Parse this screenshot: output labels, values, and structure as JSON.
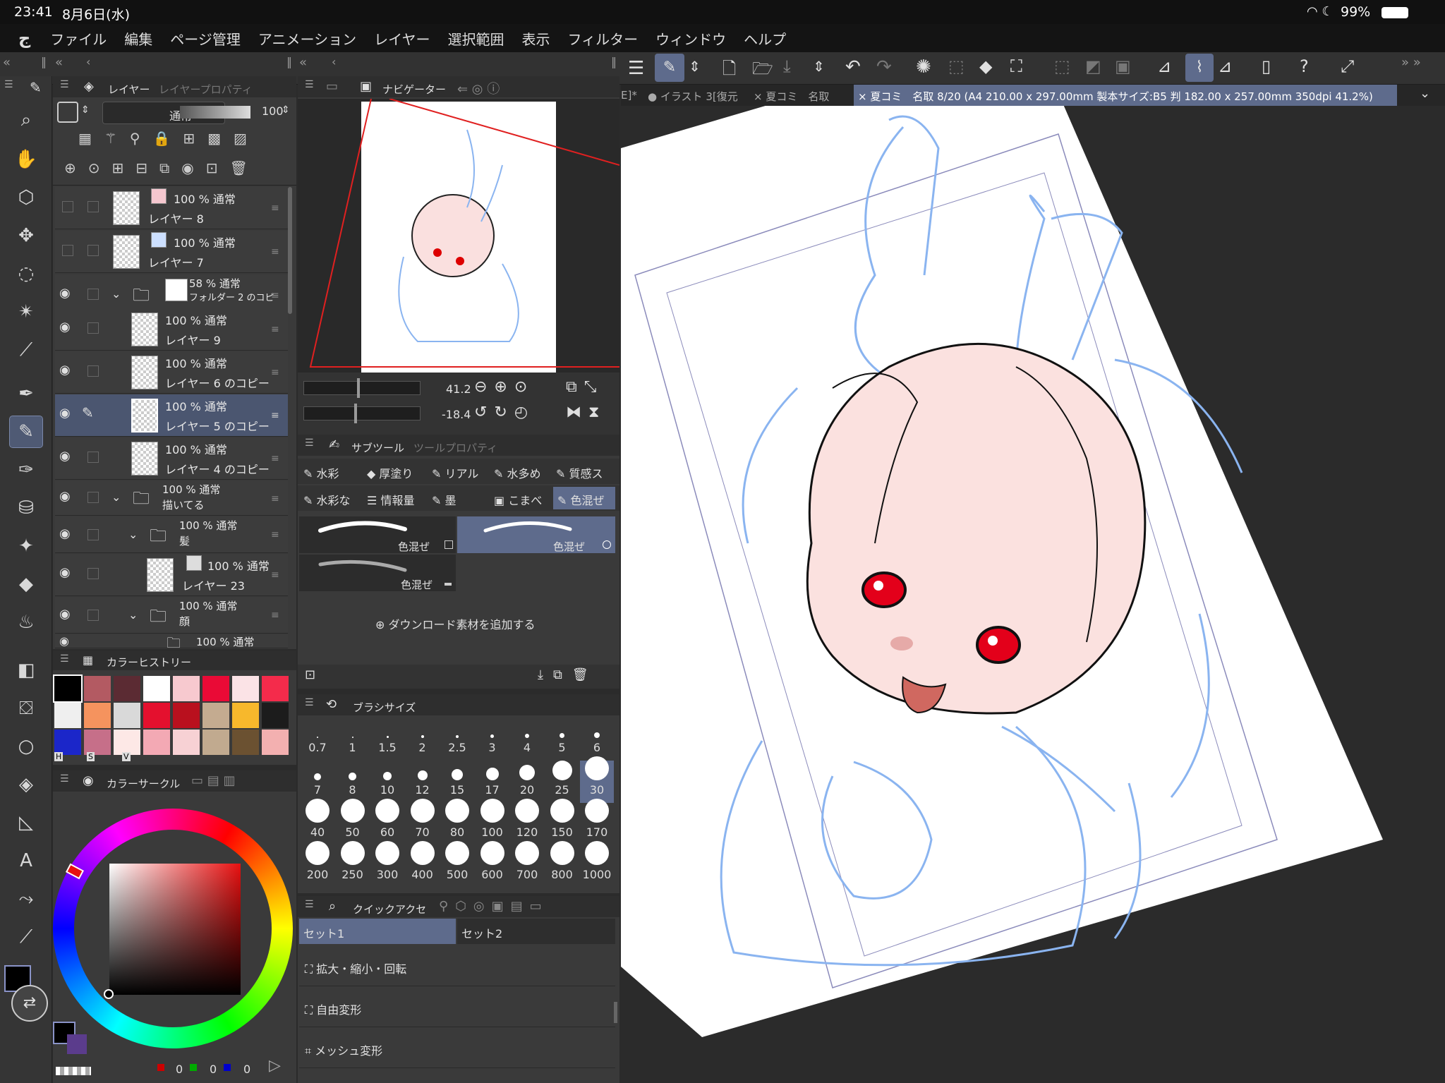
{
  "status": {
    "time": "23:41",
    "date": "8月6日(水)",
    "battery": "99%"
  },
  "menu": [
    "ファイル",
    "編集",
    "ページ管理",
    "アニメーション",
    "レイヤー",
    "選択範囲",
    "表示",
    "フィルター",
    "ウィンドウ",
    "ヘルプ"
  ],
  "layer_panel": {
    "tab_layer": "レイヤー",
    "tab_property": "レイヤープロパティ",
    "blend_mode": "通常",
    "opacity": "100",
    "layers": [
      {
        "line1": "100 % 通常",
        "line2": "レイヤー 8"
      },
      {
        "line1": "100 % 通常",
        "line2": "レイヤー 7"
      },
      {
        "line1": "58 % 通常",
        "line2": "フォルダー 2 のコピ"
      },
      {
        "line1": "100 % 通常",
        "line2": "レイヤー 9"
      },
      {
        "line1": "100 % 通常",
        "line2": "レイヤー 6 のコピー"
      },
      {
        "line1": "100 % 通常",
        "line2": "レイヤー 5 のコピー"
      },
      {
        "line1": "100 % 通常",
        "line2": "レイヤー 4 のコピー"
      },
      {
        "line1": "100 % 通常",
        "line2": "描いてる"
      },
      {
        "line1": "100 % 通常",
        "line2": "髪"
      },
      {
        "line1": "100 % 通常",
        "line2": "レイヤー 23"
      },
      {
        "line1": "100 % 通常",
        "line2": "顔"
      },
      {
        "line1": "100 % 通常",
        "line2": ""
      }
    ]
  },
  "color_history": {
    "title": "カラーヒストリー",
    "swatches": [
      "#000000",
      "#b35a62",
      "#5b2b33",
      "#ffffff",
      "#f7c9cf",
      "#ea0a36",
      "#fbe3e6",
      "#f42b4b",
      "#efefef",
      "#f5935e",
      "#d9d9d9",
      "#e4102e",
      "#b9101e",
      "#c4ab90",
      "#f7b82c",
      "#1c1c1c",
      "#1b26c9",
      "#c66f89",
      "#fde8e6",
      "#f3a9b4",
      "#f7d1d4",
      "#c1aa8f",
      "#6b5131",
      "#f3b0b0"
    ],
    "labels": [
      "H",
      "S",
      "V"
    ]
  },
  "color_circle": {
    "title": "カラーサークル",
    "r": "0",
    "g": "0",
    "b": "0"
  },
  "navigator": {
    "title": "ナビゲーター",
    "zoom": "41.2",
    "rotate": "-18.4"
  },
  "subtool": {
    "tab1": "サブツール",
    "tab2": "ツールプロパティ",
    "row1": [
      "水彩",
      "厚塗り",
      "リアル",
      "水多め",
      "質感ス"
    ],
    "row2": [
      "水彩な",
      "情報量",
      "墨",
      "こまべ",
      "色混ぜ"
    ],
    "brushes": [
      "色混ぜ",
      "色混ぜ",
      "色混ぜ"
    ],
    "add": "ダウンロード素材を追加する"
  },
  "brush_size": {
    "title": "ブラシサイズ",
    "sizes": [
      "0.7",
      "1",
      "1.5",
      "2",
      "2.5",
      "3",
      "4",
      "5",
      "6",
      "7",
      "8",
      "10",
      "12",
      "15",
      "17",
      "20",
      "25",
      "30",
      "40",
      "50",
      "60",
      "70",
      "80",
      "100",
      "120",
      "150",
      "170",
      "200",
      "250",
      "300",
      "400",
      "500",
      "600",
      "700",
      "800",
      "1000"
    ],
    "selected": "30"
  },
  "quick_access": {
    "title": "クイックアクセ",
    "set1": "セット1",
    "set2": "セット2",
    "items": [
      "拡大・縮小・回転",
      "自由変形",
      "メッシュ変形"
    ]
  },
  "doc_tabs": {
    "t0": "E]*",
    "t1": "● イラスト 3[復元",
    "t2": "× 夏コミ　名取",
    "t3": "× 夏コミ　名取 8/20 (A4 210.00 x 297.00mm 製本サイズ:B5 判 182.00 x 257.00mm 350dpi 41.2%)"
  },
  "colors": {
    "accent": "#4b5670",
    "selection": "#5e6b8c",
    "panel": "#3a3a3a"
  }
}
